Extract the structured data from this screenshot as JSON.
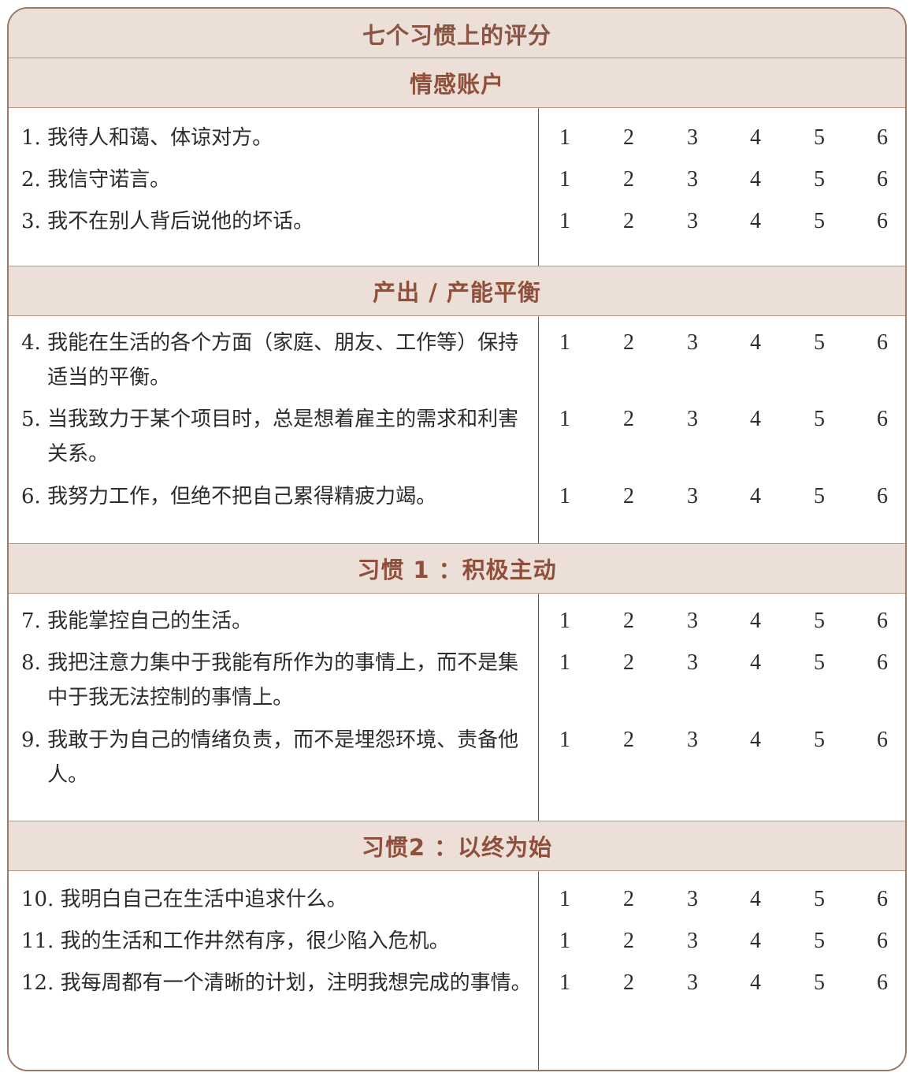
{
  "title": "七个习惯上的评分",
  "scale_values": [
    "1",
    "2",
    "3",
    "4",
    "5",
    "6"
  ],
  "sections": [
    {
      "heading": "情感账户",
      "items": [
        {
          "number": "1. ",
          "text": "我待人和蔼、体谅对方。"
        },
        {
          "number": "2. ",
          "text": "我信守诺言。"
        },
        {
          "number": "3. ",
          "text": "我不在别人背后说他的坏话。"
        }
      ]
    },
    {
      "heading": "产出 / 产能平衡",
      "items": [
        {
          "number": "4. ",
          "text": "我能在生活的各个方面（家庭、朋友、工作等）保持适当的平衡。"
        },
        {
          "number": "5. ",
          "text": "当我致力于某个项目时，总是想着雇主的需求和利害关系。"
        },
        {
          "number": "6. ",
          "text": "我努力工作，但绝不把自己累得精疲力竭。"
        }
      ]
    },
    {
      "heading": "习惯 1 ：积极主动",
      "items": [
        {
          "number": "7. ",
          "text": "我能掌控自己的生活。"
        },
        {
          "number": "8. ",
          "text": "我把注意力集中于我能有所作为的事情上，而不是集中于我无法控制的事情上。"
        },
        {
          "number": "9. ",
          "text": "我敢于为自己的情绪负责，而不是埋怨环境、责备他人。"
        }
      ]
    },
    {
      "heading": "习惯2 ：以终为始",
      "items": [
        {
          "number": "10. ",
          "text": "我明白自己在生活中追求什么。"
        },
        {
          "number": "11. ",
          "text": "我的生活和工作井然有序，很少陷入危机。"
        },
        {
          "number": "12. ",
          "text": "我每周都有一个清晰的计划，注明我想完成的事情。"
        }
      ]
    }
  ],
  "colors": {
    "band_background": "#ecdfd7",
    "heading_text": "#8f4f3b",
    "border": "#9b7766",
    "body_text": "#2c2c2c"
  }
}
